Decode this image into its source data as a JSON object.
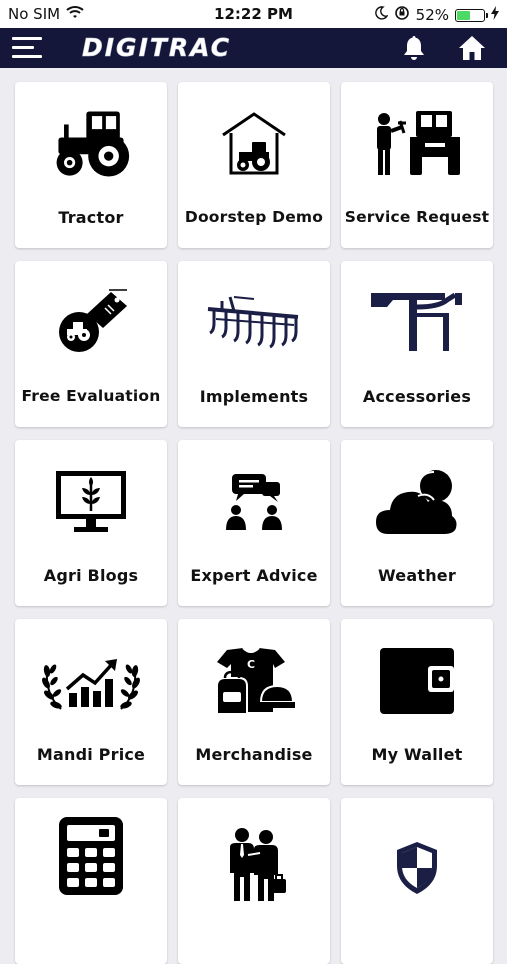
{
  "status_bar": {
    "carrier": "No SIM",
    "time": "12:22 PM",
    "battery_percent": "52%",
    "battery_level": 0.52
  },
  "header": {
    "brand": "DIGITRAC",
    "color": "#14173a"
  },
  "tiles": [
    {
      "label": "Tractor",
      "icon": "tractor-icon"
    },
    {
      "label": "Doorstep Demo",
      "icon": "garage-tractor-icon"
    },
    {
      "label": "Service Request",
      "icon": "mechanic-tractor-icon"
    },
    {
      "label": "Free Evaluation",
      "icon": "tractor-price-tag-icon"
    },
    {
      "label": "Implements",
      "icon": "cultivator-icon"
    },
    {
      "label": "Accessories",
      "icon": "loader-attachment-icon"
    },
    {
      "label": "Agri Blogs",
      "icon": "monitor-plant-icon"
    },
    {
      "label": "Expert Advice",
      "icon": "chat-people-icon"
    },
    {
      "label": "Weather",
      "icon": "cloud-sun-icon"
    },
    {
      "label": "Mandi Price",
      "icon": "laurel-chart-icon"
    },
    {
      "label": "Merchandise",
      "icon": "tshirt-bag-cap-icon"
    },
    {
      "label": "My Wallet",
      "icon": "wallet-icon"
    },
    {
      "label": "",
      "icon": "calculator-icon"
    },
    {
      "label": "",
      "icon": "business-people-icon"
    },
    {
      "label": "",
      "icon": "shield-icon"
    }
  ]
}
